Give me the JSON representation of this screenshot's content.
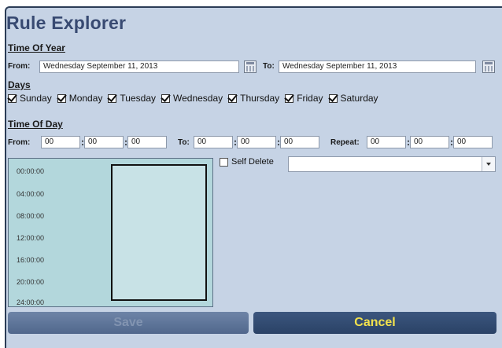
{
  "title": "Rule Explorer",
  "time_of_year": {
    "heading": "Time Of Year",
    "from_label": "From:",
    "from_value": "Wednesday September 11, 2013",
    "to_label": "To:",
    "to_value": "Wednesday September 11, 2013"
  },
  "days": {
    "heading": "Days",
    "items": [
      {
        "label": "Sunday",
        "checked": true
      },
      {
        "label": "Monday",
        "checked": true
      },
      {
        "label": "Tuesday",
        "checked": true
      },
      {
        "label": "Wednesday",
        "checked": true
      },
      {
        "label": "Thursday",
        "checked": true
      },
      {
        "label": "Friday",
        "checked": true
      },
      {
        "label": "Saturday",
        "checked": true
      }
    ]
  },
  "time_of_day": {
    "heading": "Time Of Day",
    "from_label": "From:",
    "from": [
      "00",
      "00",
      "00"
    ],
    "to_label": "To:",
    "to": [
      "00",
      "00",
      "00"
    ],
    "repeat_label": "Repeat:",
    "repeat": [
      "00",
      "00",
      "00"
    ],
    "separator": ":"
  },
  "timeline": {
    "ticks": [
      "00:00:00",
      "04:00:00",
      "08:00:00",
      "12:00:00",
      "16:00:00",
      "20:00:00",
      "24:00:00"
    ]
  },
  "self_delete": {
    "label": "Self Delete",
    "checked": false,
    "dropdown_value": ""
  },
  "buttons": {
    "save": "Save",
    "cancel": "Cancel"
  },
  "colors": {
    "panel_bg": "#c6d3e5",
    "title": "#384a72",
    "timeline_bg": "#b3d7dc",
    "cancel_text": "#f2e24d"
  }
}
